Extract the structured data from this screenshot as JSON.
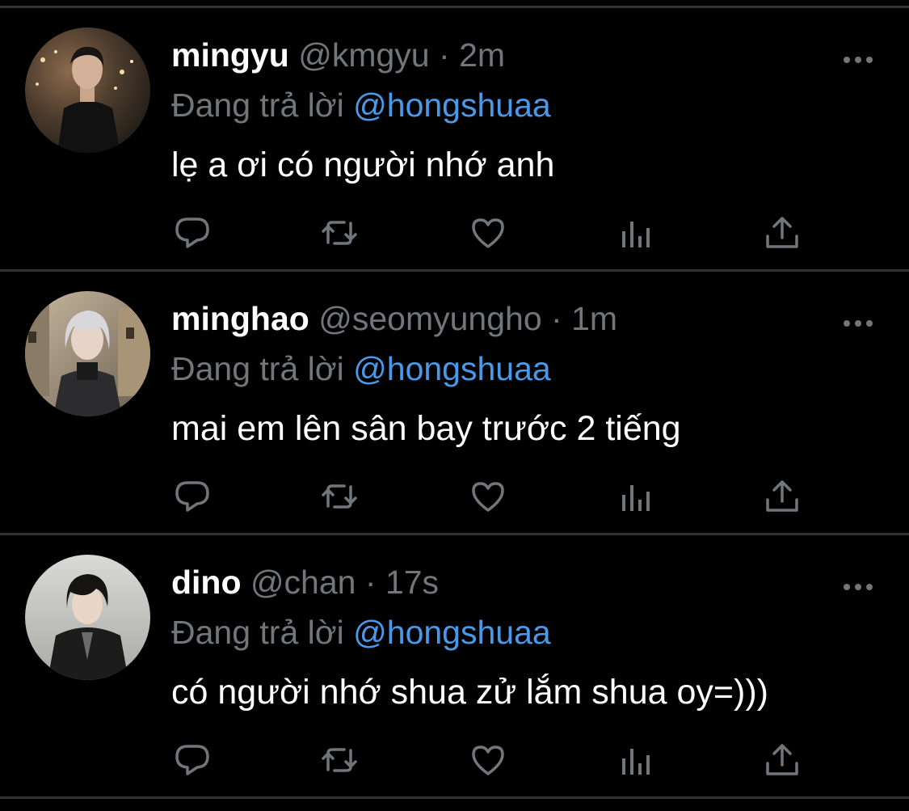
{
  "tweets": [
    {
      "display_name": "mingyu",
      "handle": "@kmgyu",
      "separator": "·",
      "time": "2m",
      "reply_prefix": "Đang trả lời",
      "reply_to": "@hongshuaa",
      "text": "lẹ a ơi có người nhớ anh",
      "avatar": "photo-man-dark-coat-night-lights"
    },
    {
      "display_name": "minghao",
      "handle": "@seomyungho",
      "separator": "·",
      "time": "1m",
      "reply_prefix": "Đang trả lời",
      "reply_to": "@hongshuaa",
      "text": "mai em lên sân bay trước 2 tiếng",
      "avatar": "photo-silver-hair-street"
    },
    {
      "display_name": "dino",
      "handle": "@chan",
      "separator": "·",
      "time": "17s",
      "reply_prefix": "Đang trả lời",
      "reply_to": "@hongshuaa",
      "text": "có người nhớ shua zử lắm shua oy=)))",
      "avatar": "photo-leather-jacket-grey-wall"
    }
  ],
  "icons": {
    "more": "more-dots-icon",
    "reply": "reply-bubble-icon",
    "retweet": "retweet-icon",
    "like": "heart-icon",
    "views": "analytics-icon",
    "share": "share-icon"
  },
  "colors": {
    "background": "#000000",
    "divider": "#2f3336",
    "secondary_text": "#71767b",
    "mention": "#4a99e9",
    "primary_text": "#ffffff"
  }
}
